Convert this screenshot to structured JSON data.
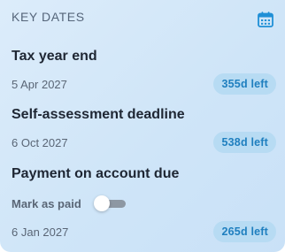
{
  "card": {
    "title": "KEY DATES",
    "calendar_icon": "calendar-icon",
    "accent_color": "#1f8fd6"
  },
  "items": [
    {
      "title": "Tax year end",
      "date": "5 Apr 2027",
      "badge": "355d left"
    },
    {
      "title": "Self-assessment deadline",
      "date": "6 Oct 2027",
      "badge": "538d left"
    },
    {
      "title": "Payment on account due",
      "mark_label": "Mark as paid",
      "mark_paid": false,
      "date": "6 Jan 2027",
      "badge": "265d left"
    }
  ]
}
